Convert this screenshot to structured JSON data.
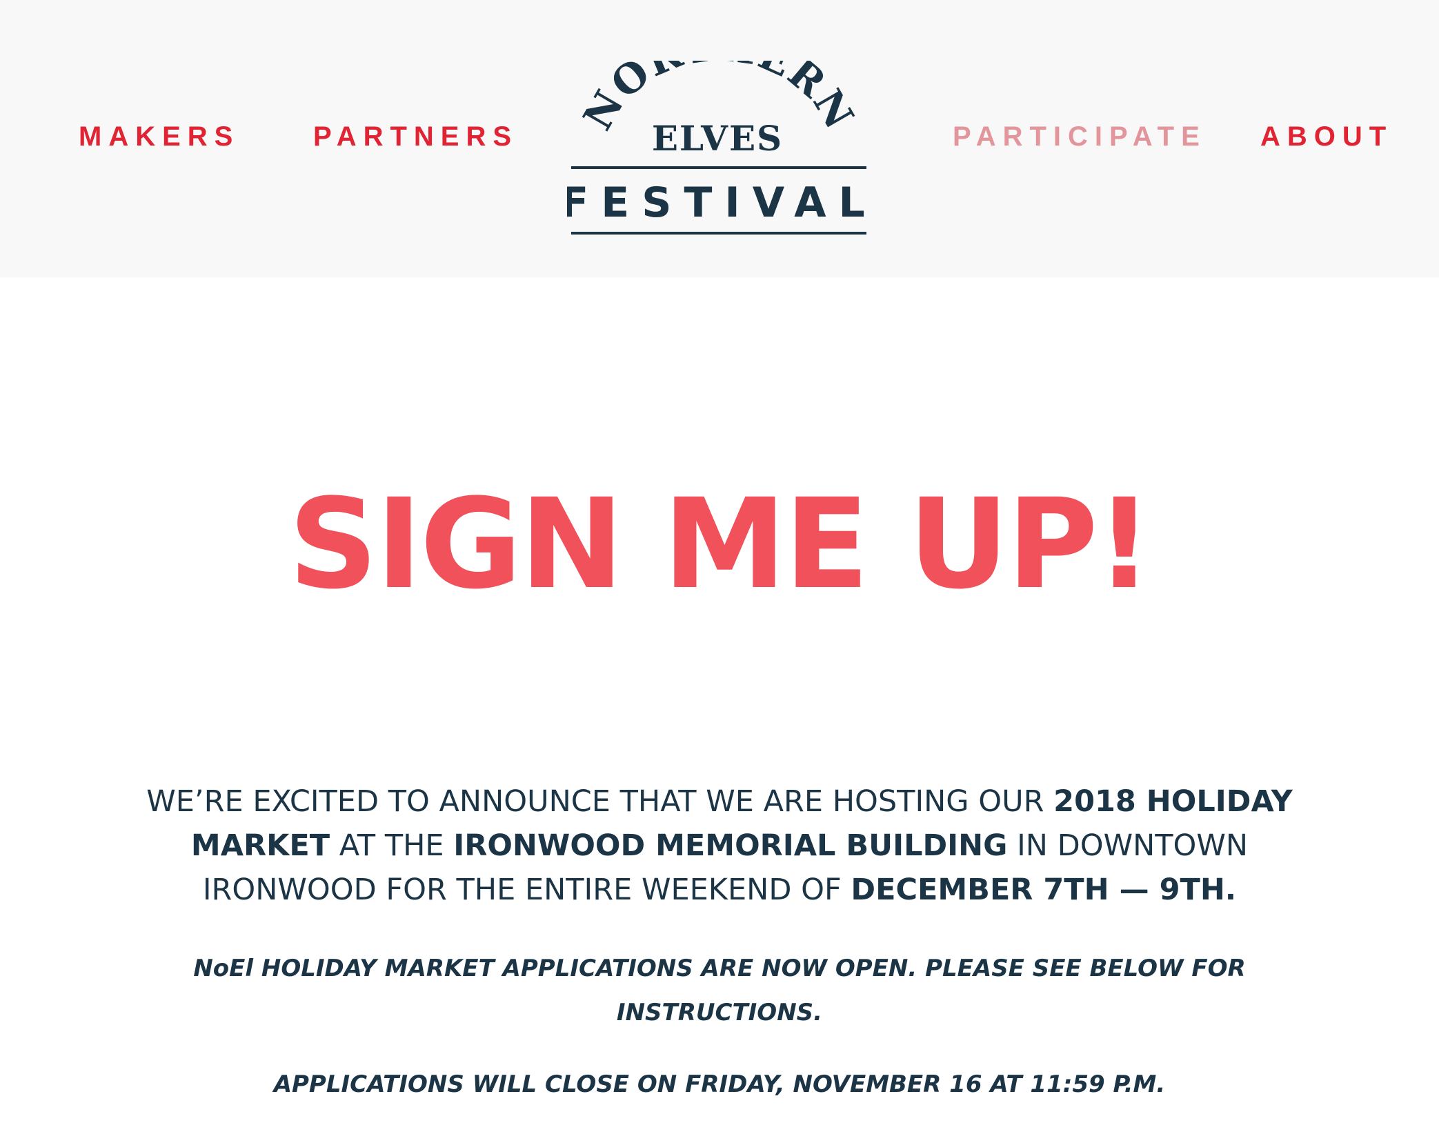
{
  "nav": {
    "makers": "MAKERS",
    "partners": "PARTNERS",
    "participate": "PARTICIPATE",
    "about": "ABOUT"
  },
  "logo": {
    "arc_text": "NORTHERN",
    "middle_text": "ELVES",
    "bottom_text": "FESTIVAL"
  },
  "hero": {
    "title": "SIGN ME UP!"
  },
  "intro": {
    "part1": "WE’RE EXCITED TO ANNOUNCE THAT WE ARE HOSTING OUR ",
    "bold1": "2018 HOLIDAY MARKET",
    "part2": " AT THE ",
    "bold2": "IRONWOOD MEMORIAL BUILDING",
    "part3": " IN DOWNTOWN IRONWOOD FOR THE ENTIRE WEEKEND OF ",
    "bold3": "DECEMBER 7TH — 9TH."
  },
  "notices": {
    "open": "NoEl HOLIDAY MARKET APPLICATIONS ARE NOW OPEN. PLEASE SEE BELOW FOR INSTRUCTIONS.",
    "close": "APPLICATIONS WILL CLOSE ON FRIDAY, NOVEMBER 16 AT 11:59 P.M."
  },
  "colors": {
    "nav_red": "#e02434",
    "nav_active": "#e3959c",
    "hero_red": "#f0515a",
    "navy": "#1c3546",
    "header_bg": "#f8f8f8"
  }
}
